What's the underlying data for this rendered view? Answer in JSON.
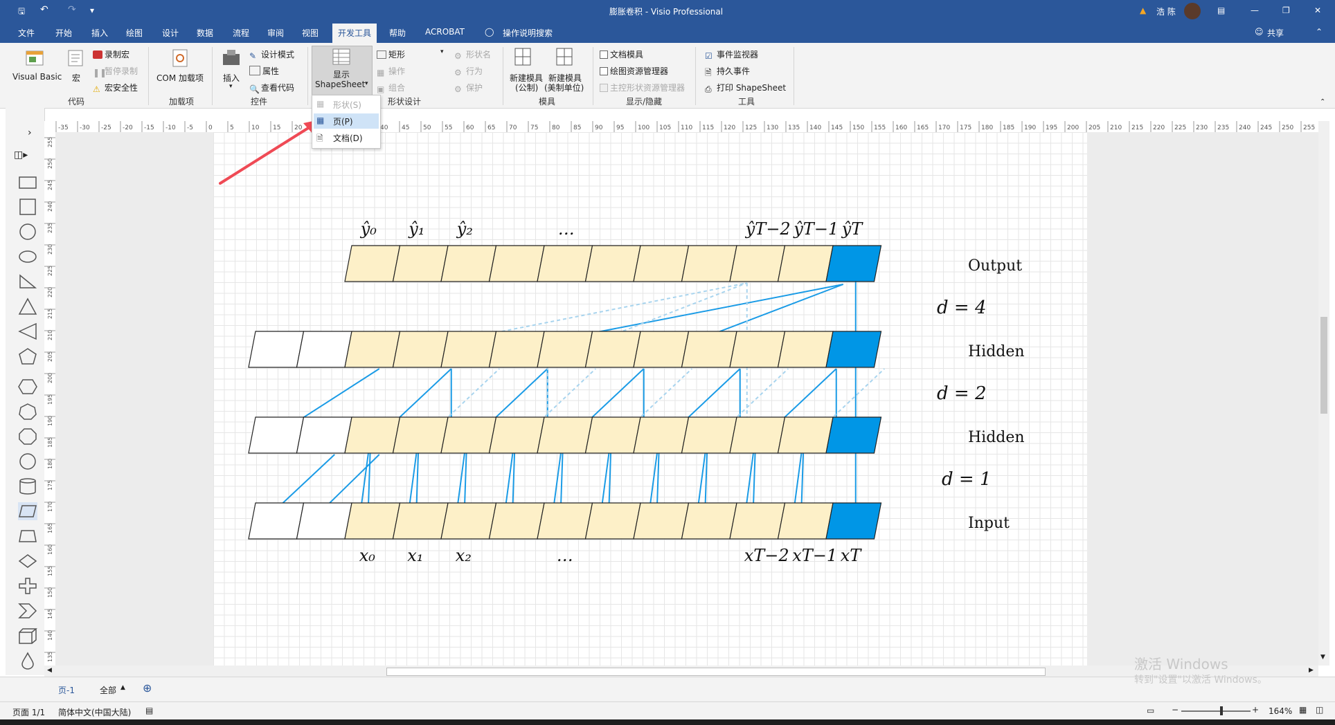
{
  "window": {
    "title": "膨胀卷积  -  Visio Professional",
    "user": "浩 陈",
    "share": "共享",
    "tell_me": "操作说明搜索"
  },
  "tabs": [
    "文件",
    "开始",
    "插入",
    "绘图",
    "设计",
    "数据",
    "流程",
    "审阅",
    "视图",
    "开发工具",
    "帮助",
    "ACROBAT"
  ],
  "active_tab": "开发工具",
  "ribbon": {
    "code": {
      "label": "代码",
      "visual_basic": "Visual Basic",
      "macros": "宏",
      "record_macro": "录制宏",
      "pause_recording": "暂停录制",
      "macro_security": "宏安全性"
    },
    "addins": {
      "label": "加载项",
      "com_addins": "COM 加载项"
    },
    "controls": {
      "label": "控件",
      "insert": "插入",
      "design_mode": "设计模式",
      "properties": "属性",
      "view_code": "查看代码"
    },
    "shape_design": {
      "label": "形状设计",
      "show_shapesheet_line1": "显示",
      "show_shapesheet_line2": "ShapeSheet",
      "rectangle": "矩形",
      "operations": "操作",
      "group": "组合",
      "shape_name": "形状名",
      "behavior": "行为",
      "protection": "保护"
    },
    "stencil": {
      "label": "模具",
      "new_stencil_metric": "新建模具",
      "new_stencil_metric_sub": "(公制)",
      "new_stencil_us": "新建模具",
      "new_stencil_us_sub": "(美制单位)"
    },
    "show_hide": {
      "label": "显示/隐藏",
      "document_stencil": "文档模具",
      "drawing_explorer": "绘图资源管理器",
      "master_explorer": "主控形状资源管理器"
    },
    "tools": {
      "label": "工具",
      "event_monitor": "事件监视器",
      "persistent_events": "持久事件",
      "print_shapesheet": "打印 ShapeSheet"
    }
  },
  "dropdown": {
    "items": [
      {
        "label": "形状(S)",
        "enabled": false
      },
      {
        "label": "页(P)",
        "enabled": true
      },
      {
        "label": "文档(D)",
        "enabled": true
      }
    ]
  },
  "hruler_ticks": [
    "-35",
    "-30",
    "-25",
    "-20",
    "-15",
    "-10",
    "-5",
    "0",
    "5",
    "10",
    "15",
    "20",
    "25",
    "30",
    "35",
    "40",
    "45",
    "50",
    "55",
    "60",
    "65",
    "70",
    "75",
    "80",
    "85",
    "90",
    "95",
    "100",
    "105",
    "110",
    "115",
    "120",
    "125",
    "130",
    "135",
    "140",
    "145",
    "150",
    "155",
    "160",
    "165",
    "170",
    "175",
    "180",
    "185",
    "190",
    "195",
    "200",
    "205",
    "210",
    "215",
    "220",
    "225",
    "230",
    "235",
    "240",
    "245",
    "250",
    "255"
  ],
  "vruler_ticks": [
    "255",
    "250",
    "245",
    "240",
    "235",
    "230",
    "225",
    "220",
    "215",
    "210",
    "205",
    "200",
    "195",
    "190",
    "185",
    "180",
    "175",
    "170",
    "165",
    "160",
    "155",
    "150",
    "145",
    "140",
    "135"
  ],
  "diagram": {
    "output_labels": [
      "ŷ₀",
      "ŷ₁",
      "ŷ₂",
      "…",
      "ŷT−2",
      "ŷT−1",
      "ŷT"
    ],
    "input_labels": [
      "x₀",
      "x₁",
      "x₂",
      "…",
      "xT−2",
      "xT−1",
      "xT"
    ],
    "row_labels": [
      "Output",
      "Hidden",
      "Hidden",
      "Input"
    ],
    "dilation_labels": [
      "d = 4",
      "d = 2",
      "d = 1"
    ],
    "colors": {
      "cell": "#fdf0c8",
      "highlight": "#0096e6",
      "line": "#1a9be6",
      "dashed": "#a8d4ee"
    }
  },
  "page_tabs": {
    "page": "页-1",
    "all": "全部"
  },
  "status": {
    "page": "页面 1/1",
    "language": "简体中文(中国大陆)",
    "zoom": "164%"
  },
  "activation": {
    "line1": "激活 Windows",
    "line2": "转到\"设置\"以激活 Windows。"
  }
}
